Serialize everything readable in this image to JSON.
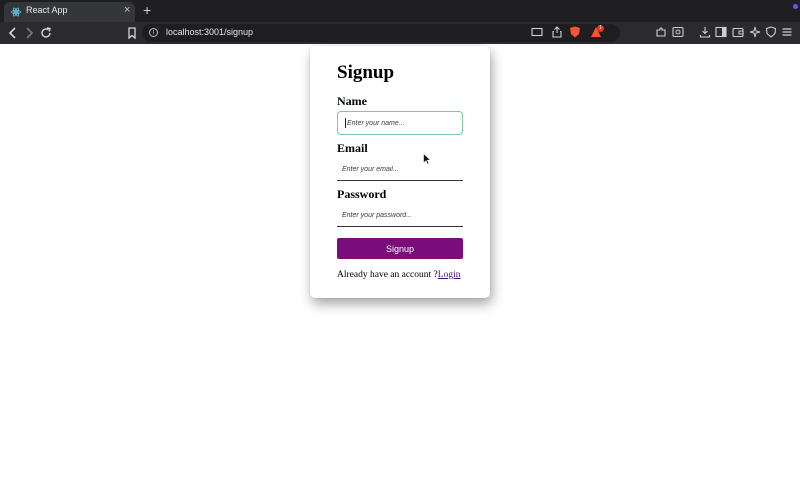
{
  "browser": {
    "tab": {
      "title": "React App",
      "close": "×"
    },
    "new_tab": "+",
    "address": "localhost:3001/signup",
    "shield_badge": "1",
    "accent": "#5a5cf0"
  },
  "signup_form": {
    "title": "Signup",
    "name": {
      "label": "Name",
      "placeholder": "Enter your name...",
      "value": ""
    },
    "email": {
      "label": "Email",
      "placeholder": "Enter your email...",
      "value": ""
    },
    "password": {
      "label": "Password",
      "placeholder": "Enter your password...",
      "value": ""
    },
    "submit_label": "Signup",
    "footer": {
      "text": "Already have an account ?",
      "link": "Login"
    },
    "colors": {
      "button": "#7a0d7a",
      "link": "#4a0f7a",
      "focus_border": "#7ec8a6"
    }
  },
  "icons": {
    "toolbar": [
      "back-icon",
      "forward-icon",
      "reload-icon",
      "bookmark-icon",
      "info-icon",
      "cast-icon",
      "share-icon",
      "brave-shield-icon",
      "brave-rewards-icon",
      "extensions-icon",
      "tab-search-icon",
      "download-icon",
      "sidebar-icon",
      "wallet-icon",
      "leo-ai-icon",
      "vpn-icon",
      "menu-icon"
    ]
  }
}
